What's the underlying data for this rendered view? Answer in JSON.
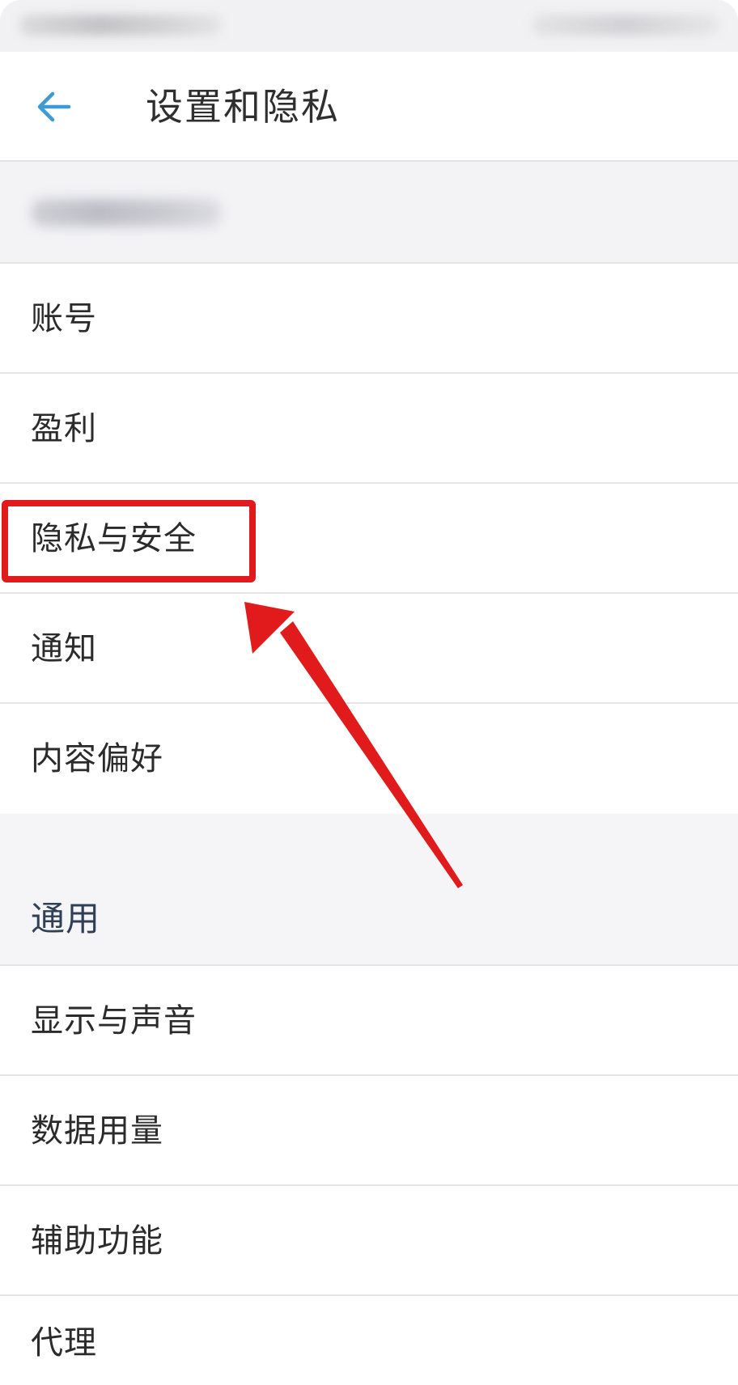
{
  "header": {
    "title": "设置和隐私",
    "back_icon": "arrow-left-icon",
    "back_icon_color": "#3d9ad6"
  },
  "settings": {
    "items": [
      {
        "label": "账号"
      },
      {
        "label": "盈利"
      },
      {
        "label": "隐私与安全"
      },
      {
        "label": "通知"
      },
      {
        "label": "内容偏好"
      }
    ]
  },
  "general": {
    "header": "通用",
    "items": [
      {
        "label": "显示与声音"
      },
      {
        "label": "数据用量"
      },
      {
        "label": "辅助功能"
      },
      {
        "label": "代理"
      }
    ]
  },
  "annotation": {
    "highlight_color": "#e11b1b",
    "highlighted_item": "隐私与安全"
  }
}
